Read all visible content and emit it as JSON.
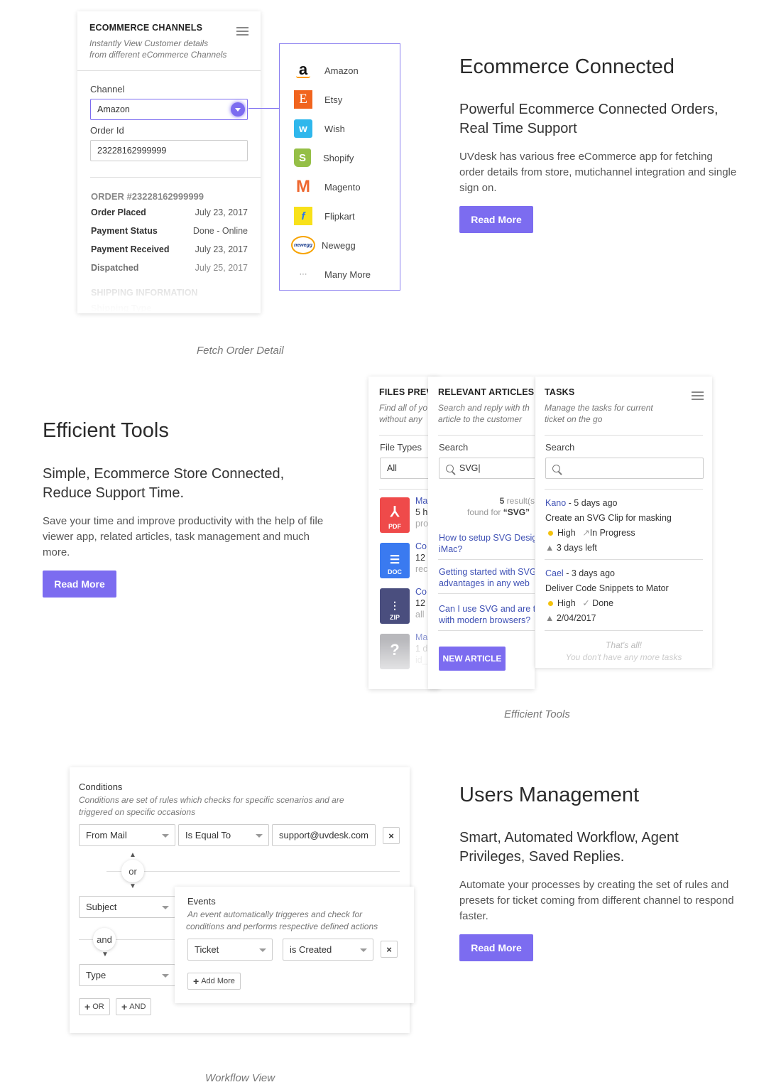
{
  "colors": {
    "accent": "#7c6cf0",
    "link": "#3f51b5"
  },
  "section1": {
    "panel": {
      "title": "ECOMMERCE CHANNELS",
      "subtitle_line1": "Instantly View Customer details",
      "subtitle_line2": "from different eCommerce Channels",
      "channel_label": "Channel",
      "channel_value": "Amazon",
      "order_id_label": "Order Id",
      "order_id_value": "23228162999999",
      "order_heading": "ORDER #23228162999999",
      "rows": [
        {
          "key": "Order Placed",
          "value": "July 23, 2017"
        },
        {
          "key": "Payment Status",
          "value": "Done - Online"
        },
        {
          "key": "Payment Received",
          "value": "July 23, 2017"
        },
        {
          "key": "Dispatched",
          "value": "July 25, 2017"
        }
      ],
      "shipping_heading": "SHIPPING INFORMATION",
      "shipping_type": "Shipping Type"
    },
    "channels": [
      {
        "name": "Amazon",
        "icon": "amazon-icon"
      },
      {
        "name": "Etsy",
        "icon": "etsy-icon"
      },
      {
        "name": "Wish",
        "icon": "wish-icon"
      },
      {
        "name": "Shopify",
        "icon": "shopify-icon"
      },
      {
        "name": "Magento",
        "icon": "magento-icon"
      },
      {
        "name": "Flipkart",
        "icon": "flipkart-icon"
      },
      {
        "name": "Newegg",
        "icon": "newegg-icon"
      },
      {
        "name": "Many More",
        "icon": "ellipsis-icon"
      }
    ],
    "caption": "Fetch Order Detail",
    "heading": "Ecommerce Connected",
    "subheading_line1": "Powerful Ecommerce Connected Orders,",
    "subheading_line2": "Real Time Support",
    "paragraph": "UVdesk has various free eCommerce app for fetching order details from store, mutichannel integration and single sign on.",
    "button": "Read More"
  },
  "section2": {
    "heading": "Efficient Tools",
    "subheading_line1": "Simple, Ecommerce Store Connected,",
    "subheading_line2": "Reduce Support Time.",
    "paragraph": "Save your time and improve productivity with the help of file viewer app, related articles, task management and much more.",
    "button": "Read More",
    "caption": "Efficient Tools",
    "files_panel": {
      "title": "FILES PREV",
      "subtitle_line1": "Find all of yo",
      "subtitle_line2": "without any",
      "file_types_label": "File Types",
      "file_types_value": "All",
      "files": [
        {
          "type": "PDF",
          "l1": "Ma",
          "l2": "5 h",
          "l3": "pro"
        },
        {
          "type": "DOC",
          "l1": "Co",
          "l2": "12",
          "l3": "rec"
        },
        {
          "type": "ZIP",
          "l1": "Co",
          "l2": "12",
          "l3": "all"
        },
        {
          "type": "?",
          "l1": "Ma",
          "l2": "1 d",
          "l3": "id_"
        }
      ]
    },
    "articles_panel": {
      "title": "RELEVANT ARTICLES",
      "subtitle_line1": "Search and reply with th",
      "subtitle_line2": "article to the customer",
      "search_label": "Search",
      "search_value": "SVG|",
      "result_count": "5",
      "result_text": "result(s",
      "found_for": "found for",
      "query": "“SVG”",
      "articles": [
        {
          "l1": "How to setup SVG Desig",
          "l2": "iMac?"
        },
        {
          "l1": "Getting started with SVG",
          "l2": "advantages in any web"
        },
        {
          "l1": "Can I use SVG and are th",
          "l2": "with modern browsers?"
        }
      ],
      "new_article_button": "NEW ARTICLE"
    },
    "tasks_panel": {
      "title": "TASKS",
      "subtitle_line1": "Manage the tasks for current",
      "subtitle_line2": "ticket on the go",
      "search_label": "Search",
      "search_value": "",
      "tasks": [
        {
          "author": "Kano",
          "time": " - 5 days ago",
          "title": "Create an SVG Clip for masking",
          "priority": "High",
          "status": "In Progress",
          "due": "3 days left"
        },
        {
          "author": "Cael",
          "time": " - 3 days ago",
          "title": "Deliver Code Snippets to Mator",
          "priority": "High",
          "status": "Done",
          "due": "2/04/2017"
        }
      ],
      "end_line1": "That's all!",
      "end_line2": "You don't have any more tasks"
    }
  },
  "section3": {
    "heading": "Users Management",
    "subheading_line1": "Smart, Automated Workflow, Agent",
    "subheading_line2": "Privileges, Saved Replies.",
    "paragraph": "Automate your processes by creating the set of rules and presets for ticket coming from different channel to respond faster.",
    "button": "Read More",
    "caption": "Workflow View",
    "conditions": {
      "title": "Conditions",
      "desc_line1": "Conditions are set of rules which checks for specific scenarios and are",
      "desc_line2": "triggered on specific occasions",
      "field1": "From Mail",
      "operator1": "Is Equal To",
      "value1": "support@uvdesk.com",
      "or_label": "or",
      "field2": "Subject",
      "and_label": "and",
      "field3": "Type",
      "add_or": "OR",
      "add_and": "AND"
    },
    "events": {
      "title": "Events",
      "desc_line1": "An event automatically  triggeres and check for",
      "desc_line2": "conditions and performs respective defined actions",
      "field": "Ticket",
      "operator": "is Created",
      "add_more": "Add More"
    }
  }
}
